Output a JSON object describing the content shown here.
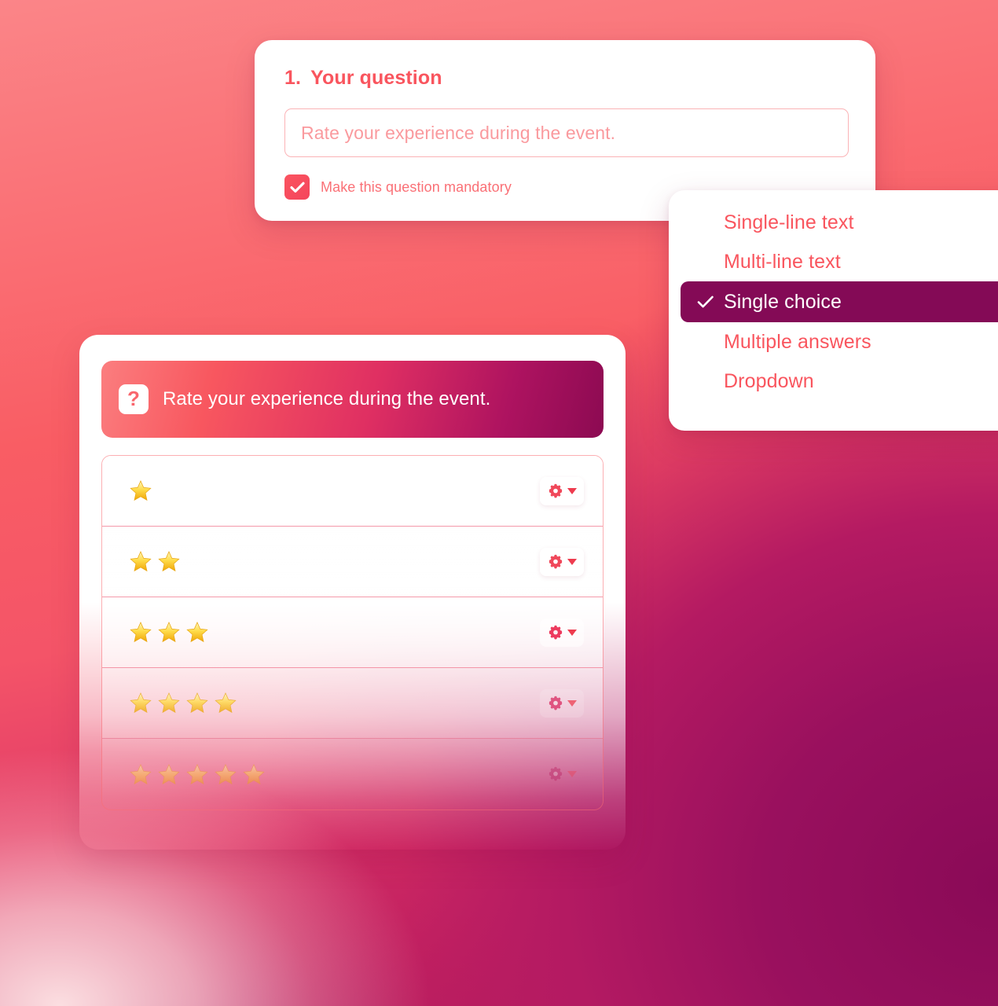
{
  "background": {
    "coral_top": "#FB8588",
    "coral_mid": "#F95D64",
    "magenta_deep": "#8A0A57",
    "glow_bottom_left": "#FFE9E8"
  },
  "question_card": {
    "number": "1.",
    "title": "Your question",
    "input": {
      "value": "",
      "placeholder": "Rate your experience during the event."
    },
    "mandatory_checkbox": {
      "label": "Make this question mandatory",
      "checked": true,
      "icon": "checkmark-icon"
    }
  },
  "type_dropdown": {
    "selected": "Single choice",
    "check_icon": "check-icon",
    "items": [
      {
        "label": "Single-line text",
        "selected": false
      },
      {
        "label": "Multi-line text",
        "selected": false
      },
      {
        "label": "Single choice",
        "selected": true
      },
      {
        "label": "Multiple answers",
        "selected": false
      },
      {
        "label": "Dropdown",
        "selected": false
      }
    ],
    "accent_text": "#F9555E",
    "selected_bg": "#840A56"
  },
  "preview_card": {
    "header": {
      "badge_icon": "question-mark-icon",
      "badge_glyph": "?",
      "text": "Rate your experience during the event.",
      "gradient_from": "#FB7E7F",
      "gradient_to": "#8C0A52"
    },
    "options": [
      {
        "stars": 1,
        "gear_icon": "gear-icon",
        "caret_icon": "chevron-down-icon"
      },
      {
        "stars": 2,
        "gear_icon": "gear-icon",
        "caret_icon": "chevron-down-icon"
      },
      {
        "stars": 3,
        "gear_icon": "gear-icon",
        "caret_icon": "chevron-down-icon"
      },
      {
        "stars": 4,
        "gear_icon": "gear-icon",
        "caret_icon": "chevron-down-icon"
      },
      {
        "stars": 5,
        "gear_icon": "gear-icon",
        "caret_icon": "chevron-down-icon"
      }
    ]
  }
}
